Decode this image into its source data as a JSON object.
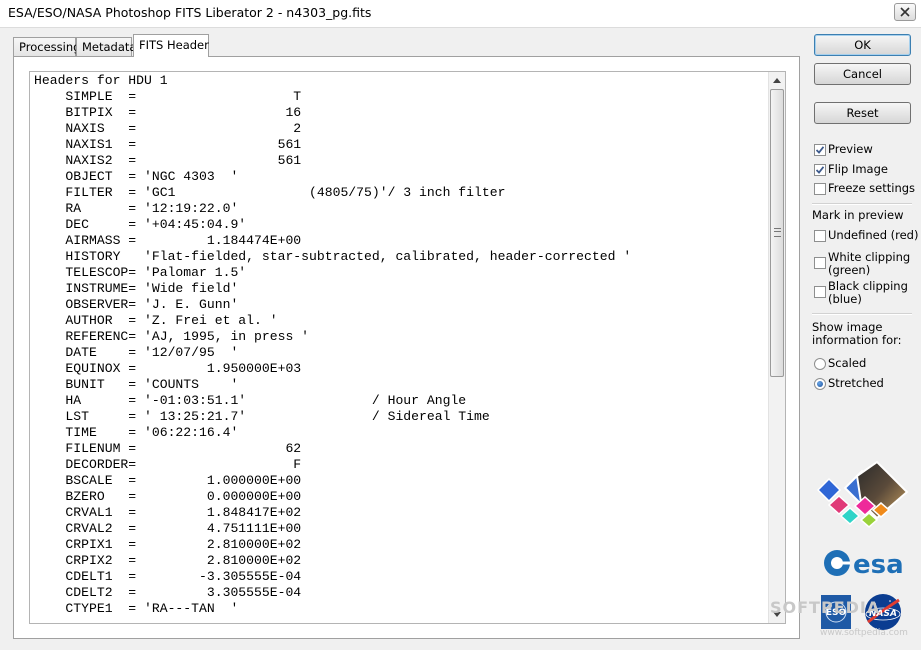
{
  "window": {
    "title": "ESA/ESO/NASA Photoshop FITS Liberator 2 - n4303_pg.fits"
  },
  "tabs": [
    {
      "label": "Processing"
    },
    {
      "label": "Metadata"
    },
    {
      "label": "FITS Header"
    }
  ],
  "header_text": "Headers for HDU 1\n    SIMPLE  =                    T\n    BITPIX  =                   16\n    NAXIS   =                    2\n    NAXIS1  =                  561\n    NAXIS2  =                  561\n    OBJECT  = 'NGC 4303  '\n    FILTER  = 'GC1                 (4805/75)'/ 3 inch filter\n    RA      = '12:19:22.0'\n    DEC     = '+04:45:04.9'\n    AIRMASS =         1.184474E+00\n    HISTORY   'Flat-fielded, star-subtracted, calibrated, header-corrected '\n    TELESCOP= 'Palomar 1.5'\n    INSTRUME= 'Wide field'\n    OBSERVER= 'J. E. Gunn'\n    AUTHOR  = 'Z. Frei et al. '\n    REFERENC= 'AJ, 1995, in press '\n    DATE    = '12/07/95  '\n    EQUINOX =         1.950000E+03\n    BUNIT   = 'COUNTS    '\n    HA      = '-01:03:51.1'                / Hour Angle\n    LST     = ' 13:25:21.7'                / Sidereal Time\n    TIME    = '06:22:16.4'\n    FILENUM =                   62\n    DECORDER=                    F\n    BSCALE  =         1.000000E+00\n    BZERO   =         0.000000E+00\n    CRVAL1  =         1.848417E+02\n    CRVAL2  =         4.751111E+00\n    CRPIX1  =         2.810000E+02\n    CRPIX2  =         2.810000E+02\n    CDELT1  =        -3.305555E-04\n    CDELT2  =         3.305555E-04\n    CTYPE1  = 'RA---TAN  '",
  "buttons": {
    "ok": "OK",
    "cancel": "Cancel",
    "reset": "Reset"
  },
  "options": {
    "preview": {
      "label": "Preview",
      "checked": true
    },
    "flip_image": {
      "label": "Flip Image",
      "checked": true
    },
    "freeze_settings": {
      "label": "Freeze settings",
      "checked": false
    }
  },
  "mark_in_preview": {
    "heading": "Mark in preview",
    "undefined": {
      "label": "Undefined (red)",
      "checked": false
    },
    "white_line1": "White clipping",
    "white_line2": "(green)",
    "white_checked": false,
    "black_line1": "Black clipping",
    "black_line2": "(blue)",
    "black_checked": false
  },
  "show_info": {
    "heading_line1": "Show image",
    "heading_line2": "information for:",
    "scaled": {
      "label": "Scaled",
      "selected": false
    },
    "stretched": {
      "label": "Stretched",
      "selected": true
    }
  },
  "logos": {
    "esa": "esa",
    "nasa": "NASA",
    "eso": "ESO"
  },
  "watermark": {
    "text": "SOFTPEDIA",
    "url": "www.softpedia.com"
  },
  "colors": {
    "accent_check": "#3d5a8c",
    "esa_blue": "#1e6fb6",
    "nasa_blue": "#0b3d91",
    "nasa_red": "#e03c31"
  }
}
